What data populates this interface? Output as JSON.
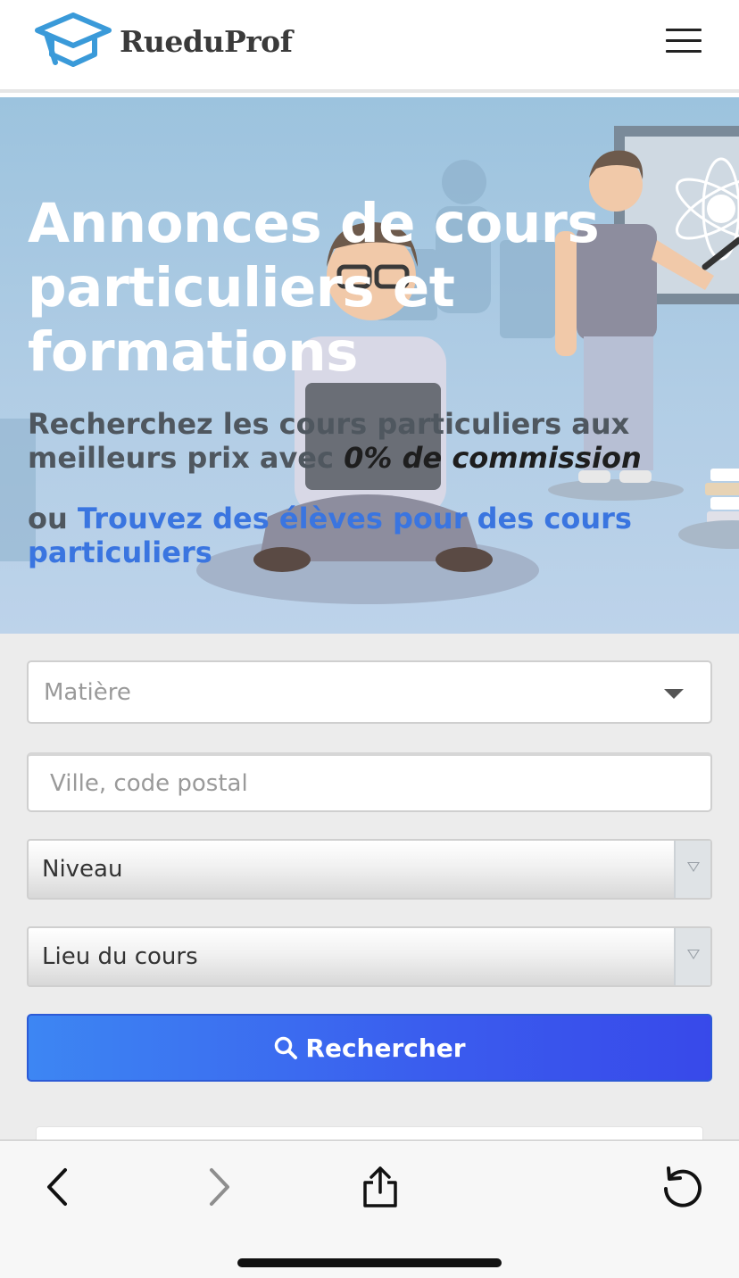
{
  "header": {
    "brand": "RueduProf",
    "menu_icon": "hamburger-menu-icon",
    "logo_icon": "graduation-cap-icon"
  },
  "hero": {
    "title": "Annonces de cours particuliers et formations",
    "subtitle_prefix": "Recherchez les cours particuliers aux meilleurs prix avec ",
    "subtitle_emphasis": "0% de commission",
    "cta_prefix": "ou ",
    "cta_link": "Trouvez des élèves pour des cours particuliers"
  },
  "search": {
    "subject_placeholder": "Matière",
    "location_placeholder": "Ville, code postal",
    "level_selected": "Niveau",
    "place_selected": "Lieu du cours",
    "submit_label": "Rechercher",
    "submit_icon": "search-icon"
  },
  "browser_toolbar": {
    "back_icon": "chevron-left-icon",
    "forward_icon": "chevron-right-icon",
    "share_icon": "share-icon",
    "reload_icon": "reload-icon"
  },
  "colors": {
    "brand_blue": "#3a9ad9",
    "link_blue": "#3a75e0",
    "button_blue": "#3a5cee",
    "hero_bg": "#a8c8e2"
  }
}
